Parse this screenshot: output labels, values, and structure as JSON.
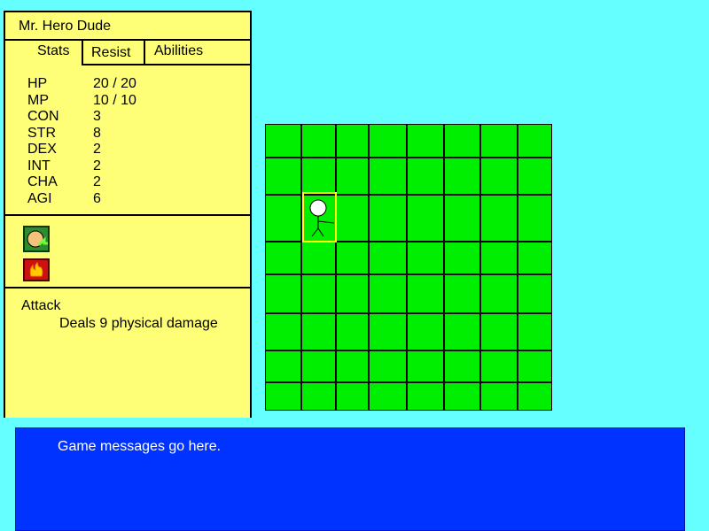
{
  "character": {
    "name": "Mr. Hero Dude"
  },
  "tabs": {
    "stats": "Stats",
    "resist": "Resist",
    "abilities": "Abilities"
  },
  "stats": [
    {
      "label": "HP",
      "value": "20 / 20"
    },
    {
      "label": "MP",
      "value": "10 / 10"
    },
    {
      "label": "CON",
      "value": "3"
    },
    {
      "label": "STR",
      "value": "8"
    },
    {
      "label": "DEX",
      "value": "2"
    },
    {
      "label": "INT",
      "value": "2"
    },
    {
      "label": "CHA",
      "value": "2"
    },
    {
      "label": "AGI",
      "value": "6"
    }
  ],
  "abilities": {
    "icons": [
      "attack-ability-icon",
      "fire-ability-icon"
    ],
    "selected": {
      "name": "Attack",
      "description": "Deals 9 physical damage"
    }
  },
  "map": {
    "columns": 8,
    "rows": 8,
    "tile_color": "#00ee00",
    "player": {
      "col": 1,
      "row": 2,
      "highlight_color": "#ffff00"
    }
  },
  "messages": {
    "text": "Game messages go here."
  },
  "colors": {
    "background": "#66ffff",
    "panel": "#ffff77",
    "message_box": "#0033ff"
  }
}
